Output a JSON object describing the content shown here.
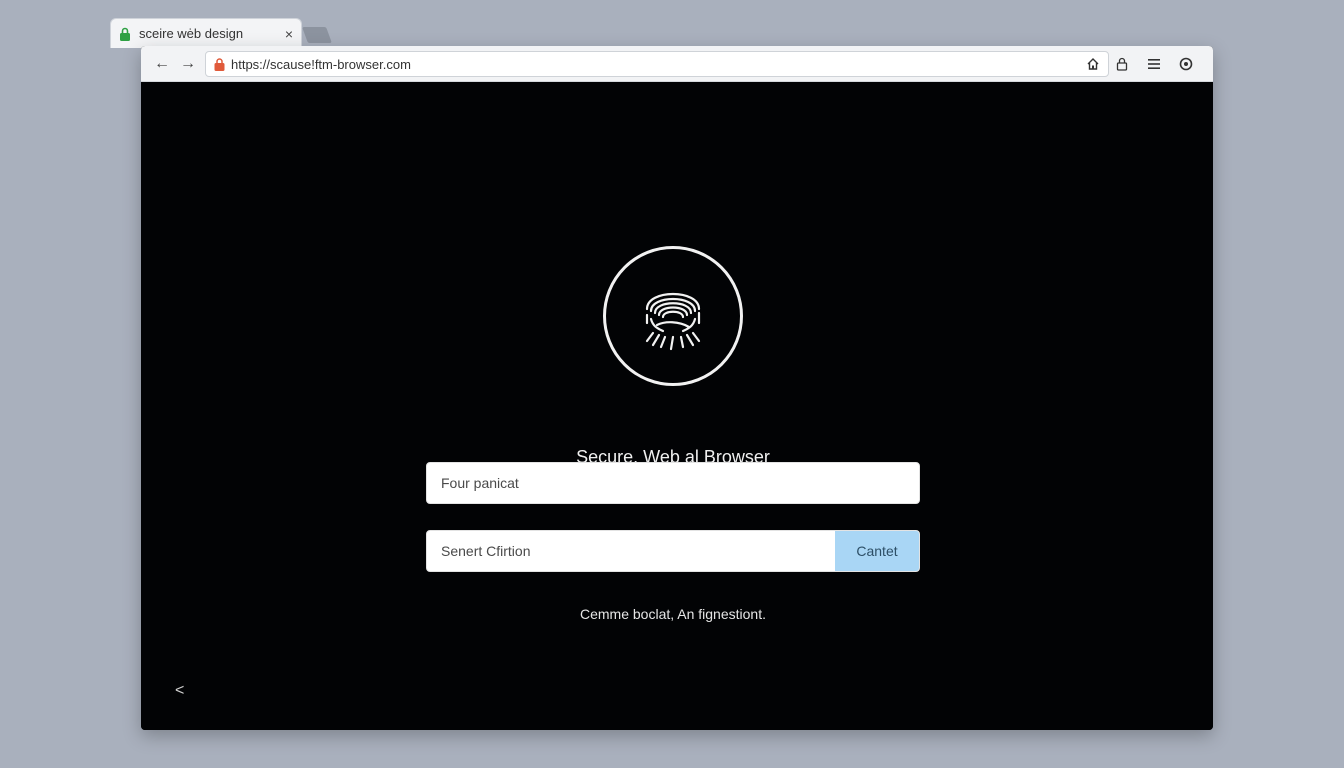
{
  "tab": {
    "title": "sceire wėb design",
    "close_glyph": "×",
    "lock_color": "#2ea043"
  },
  "toolbar": {
    "back_glyph": "←",
    "forward_glyph": "→",
    "url": "https://scause!ftm-browser.com",
    "url_lock_color": "#e05a3a",
    "icons": [
      "home-icon",
      "lock-icon",
      "menu-icon",
      "settings-icon"
    ]
  },
  "content": {
    "app_title": "Secure, Web al Browser",
    "field1_placeholder": "Four panicat",
    "field2_placeholder": "Senert Cfirtion",
    "submit_label": "Cantet",
    "hint": "Cemme boclat, An fignestiont.",
    "back_glyph": "<"
  },
  "colors": {
    "background": "#a9b0bd",
    "content_bg": "#020305",
    "button_bg": "#a9d6f5"
  }
}
